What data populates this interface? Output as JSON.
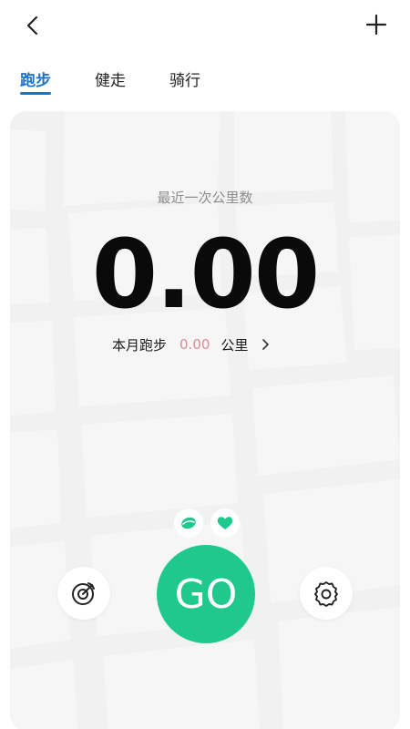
{
  "topbar": {
    "back_icon": "chevron-left-icon",
    "add_icon": "plus-icon"
  },
  "tabs": [
    {
      "label": "跑步",
      "active": true
    },
    {
      "label": "健走",
      "active": false
    },
    {
      "label": "骑行",
      "active": false
    }
  ],
  "stats": {
    "recent_label": "最近一次公里数",
    "recent_km": "0.00",
    "month_label": "本月跑步",
    "month_value": "0.00",
    "month_unit": "公里"
  },
  "controls": {
    "go_label": "GO",
    "shoe_icon": "shoe-icon",
    "heart_icon": "heart-icon",
    "target_icon": "target-icon",
    "settings_icon": "gear-icon"
  },
  "colors": {
    "accent": "#1a73c9",
    "go": "#1ec98b",
    "month_value": "#d98a92",
    "map_bg": "#f1f1f1"
  }
}
